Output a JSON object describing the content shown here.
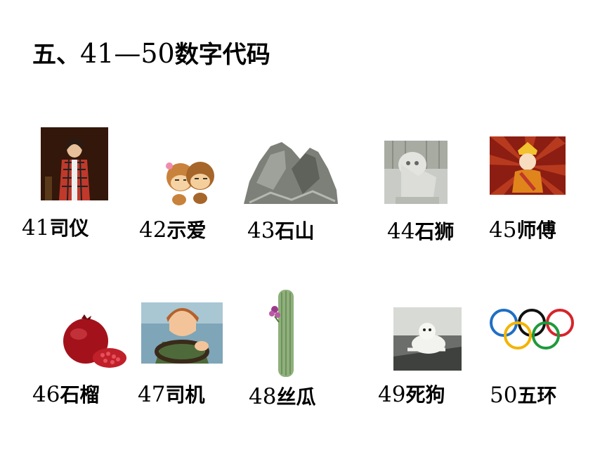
{
  "title": {
    "prefix": "五、",
    "range": "41—50",
    "suffix": "数字代码"
  },
  "items": [
    {
      "num": "41",
      "word": "司仪",
      "image": "host-photo"
    },
    {
      "num": "42",
      "word": "示爱",
      "image": "monkeys-cartoon"
    },
    {
      "num": "43",
      "word": "石山",
      "image": "rock-mountain"
    },
    {
      "num": "44",
      "word": "石狮",
      "image": "stone-lion"
    },
    {
      "num": "45",
      "word": "师傅",
      "image": "tang-monk-cartoon"
    },
    {
      "num": "46",
      "word": "石榴",
      "image": "pomegranate"
    },
    {
      "num": "47",
      "word": "司机",
      "image": "driver-cartoon"
    },
    {
      "num": "48",
      "word": "丝瓜",
      "image": "loofah"
    },
    {
      "num": "49",
      "word": "死狗",
      "image": "lying-dog"
    },
    {
      "num": "50",
      "word": "五环",
      "image": "olympic-rings"
    }
  ],
  "colors": {
    "ring_blue": "#1f6fc4",
    "ring_yellow": "#f2b400",
    "ring_black": "#111111",
    "ring_green": "#1e9a3c",
    "ring_red": "#d6242b"
  }
}
